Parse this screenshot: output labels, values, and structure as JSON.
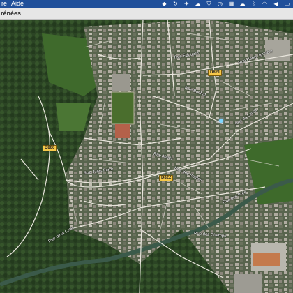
{
  "menubar": {
    "items": [
      "re",
      "Aide"
    ]
  },
  "titlebar": {
    "title": "rénées"
  },
  "map": {
    "road_shields": [
      "D806",
      "D821",
      "D822"
    ],
    "street_labels": [
      "Rue Henry Tonnère",
      "Rue Alexis",
      "Rue du Lavoir",
      "Rue des Bordes",
      "Rue Jules Ferry",
      "Rue des Prés",
      "Rue des Champs",
      "Rue de la Croix",
      "Rue Bouhat",
      "Rue Édouard"
    ]
  }
}
